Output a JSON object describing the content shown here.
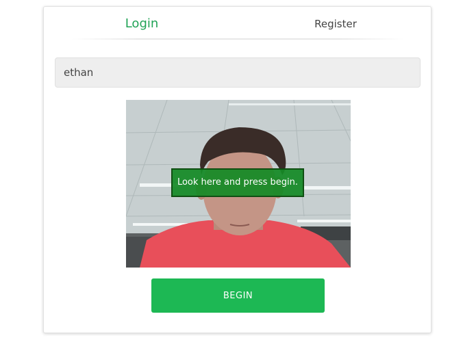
{
  "tabs": {
    "login_label": "Login",
    "register_label": "Register"
  },
  "form": {
    "username_value": "ethan"
  },
  "camera": {
    "overlay_message": "Look here and press begin."
  },
  "actions": {
    "begin_label": "BEGIN"
  },
  "colors": {
    "accent": "#21a356",
    "button": "#1db854",
    "overlay": "#148a26",
    "input_bg": "#eeeeee"
  }
}
